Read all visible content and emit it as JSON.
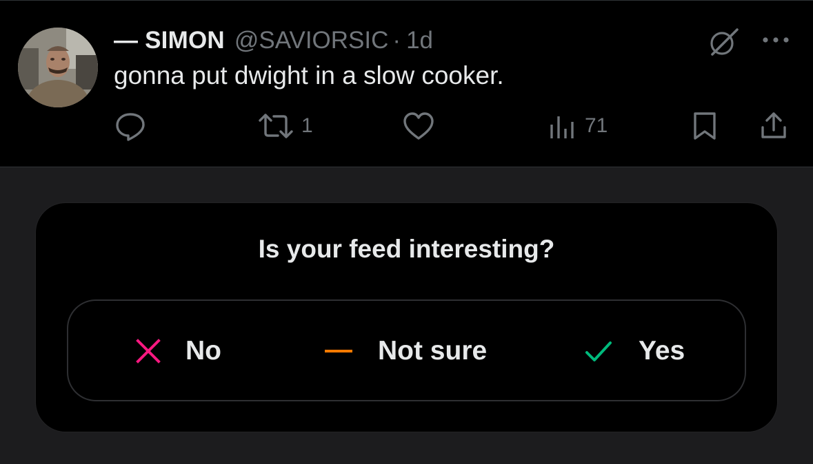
{
  "tweet": {
    "display_name": "— SIMON",
    "handle": "@SAVIORSIC",
    "separator": "·",
    "time": "1d",
    "text": "gonna put dwight in a slow cooker.",
    "actions": {
      "reply": {
        "icon": "reply-icon",
        "count": ""
      },
      "repost": {
        "icon": "repost-icon",
        "count": "1"
      },
      "like": {
        "icon": "heart-icon",
        "count": ""
      },
      "views": {
        "icon": "views-icon",
        "count": "71"
      },
      "bookmark": {
        "icon": "bookmark-icon"
      },
      "share": {
        "icon": "share-icon"
      }
    },
    "top_icons": [
      "grok-icon",
      "more-icon"
    ]
  },
  "feedback": {
    "title": "Is your feed interesting?",
    "options": [
      {
        "label": "No",
        "icon": "x-icon",
        "color": "#f91880"
      },
      {
        "label": "Not sure",
        "icon": "dash-icon",
        "color": "#ff7a00"
      },
      {
        "label": "Yes",
        "icon": "check-icon",
        "color": "#00ba7c"
      }
    ]
  },
  "colors": {
    "background": "#1c1c1e",
    "tweet_background": "#000000",
    "text_primary": "#e7e9ea",
    "text_secondary": "#71767b"
  }
}
